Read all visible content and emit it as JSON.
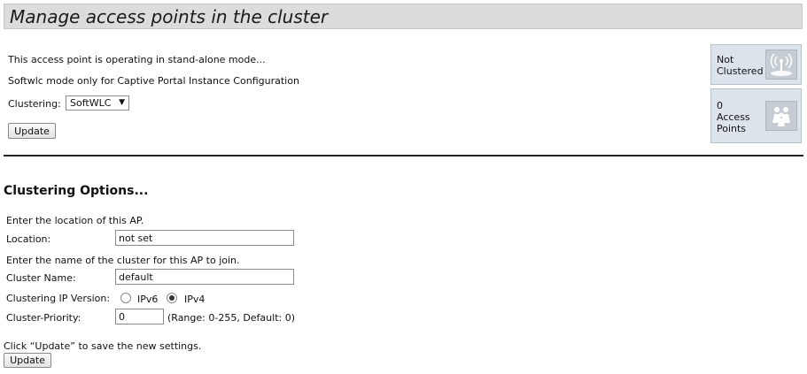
{
  "header": {
    "title": "Manage access points in the cluster"
  },
  "info": {
    "line1": "This access point is operating in stand-alone mode...",
    "line2": "Softwlc mode only for Captive Portal Instance Configuration",
    "clustering_label": "Clustering:",
    "clustering_value": "SoftWLC",
    "update_label": "Update"
  },
  "status": {
    "clustered_line1": "Not",
    "clustered_line2": "Clustered",
    "ap_count": "0",
    "ap_line1": "Access",
    "ap_line2": "Points",
    "clustered_icon": "signal-icon",
    "ap_icon": "people-icon"
  },
  "options": {
    "title": "Clustering Options...",
    "location_hint": "Enter the location of this AP.",
    "location_label": "Location:",
    "location_value": "not set",
    "cluster_hint": "Enter the name of the cluster for this AP to join.",
    "cluster_name_label": "Cluster Name:",
    "cluster_name_value": "default",
    "ip_version_label": "Clustering IP Version:",
    "ipv6_label": "IPv6",
    "ipv4_label": "IPv4",
    "ip_version_selected": "IPv4",
    "priority_label": "Cluster-Priority:",
    "priority_value": "0",
    "priority_range": "(Range: 0-255, Default: 0)",
    "save_hint": "Click “Update” to save the new settings.",
    "update_label": "Update"
  }
}
